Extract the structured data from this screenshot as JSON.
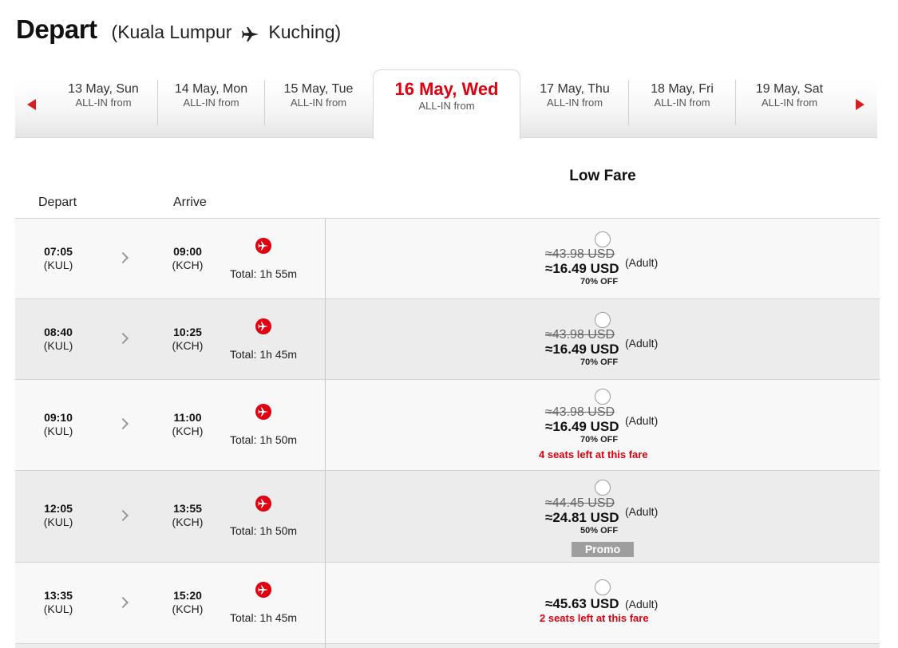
{
  "header": {
    "title": "Depart",
    "open_paren": "(",
    "origin": "Kuala Lumpur",
    "destination": "Kuching",
    "close_paren": ")"
  },
  "date_nav": {
    "dates": [
      {
        "date": "13 May, Sun",
        "sub": "ALL-IN from"
      },
      {
        "date": "14 May, Mon",
        "sub": "ALL-IN from"
      },
      {
        "date": "15 May, Tue",
        "sub": "ALL-IN from"
      },
      {
        "date": "16 May, Wed",
        "sub": "ALL-IN from"
      },
      {
        "date": "17 May, Thu",
        "sub": "ALL-IN from"
      },
      {
        "date": "18 May, Fri",
        "sub": "ALL-IN from"
      },
      {
        "date": "19 May, Sat",
        "sub": "ALL-IN from"
      }
    ],
    "active": "16 May, Wed"
  },
  "table": {
    "fare_header": "Low Fare",
    "depart_header": "Depart",
    "arrive_header": "Arrive"
  },
  "flights": [
    {
      "depart_time": "07:05",
      "depart_code": "(KUL)",
      "arrive_time": "09:00",
      "arrive_code": "(KCH)",
      "duration": "Total: 1h 55m",
      "old_price": "≈43.98 USD",
      "price": "≈16.49 USD",
      "pax": "(Adult)",
      "discount": "70% OFF",
      "seats": "",
      "promo": ""
    },
    {
      "depart_time": "08:40",
      "depart_code": "(KUL)",
      "arrive_time": "10:25",
      "arrive_code": "(KCH)",
      "duration": "Total: 1h 45m",
      "old_price": "≈43.98 USD",
      "price": "≈16.49 USD",
      "pax": "(Adult)",
      "discount": "70% OFF",
      "seats": "",
      "promo": ""
    },
    {
      "depart_time": "09:10",
      "depart_code": "(KUL)",
      "arrive_time": "11:00",
      "arrive_code": "(KCH)",
      "duration": "Total: 1h 50m",
      "old_price": "≈43.98 USD",
      "price": "≈16.49 USD",
      "pax": "(Adult)",
      "discount": "70% OFF",
      "seats": "4 seats left at this fare",
      "promo": ""
    },
    {
      "depart_time": "12:05",
      "depart_code": "(KUL)",
      "arrive_time": "13:55",
      "arrive_code": "(KCH)",
      "duration": "Total: 1h 50m",
      "old_price": "≈44.45 USD",
      "price": "≈24.81 USD",
      "pax": "(Adult)",
      "discount": "50% OFF",
      "seats": "",
      "promo": "Promo"
    },
    {
      "depart_time": "13:35",
      "depart_code": "(KUL)",
      "arrive_time": "15:20",
      "arrive_code": "(KCH)",
      "duration": "Total: 1h 45m",
      "old_price": "",
      "price": "≈45.63 USD",
      "pax": "(Adult)",
      "discount": "",
      "seats": "2 seats left at this fare",
      "promo": ""
    }
  ],
  "icons": {
    "plane": "plane-icon",
    "airline": "airasia-logo-icon",
    "prev": "arrow-left-icon",
    "next": "arrow-right-icon",
    "chevron": "chevron-right-icon"
  },
  "colors": {
    "accent": "#e0000f",
    "promo_badge": "#9e9e9e"
  }
}
